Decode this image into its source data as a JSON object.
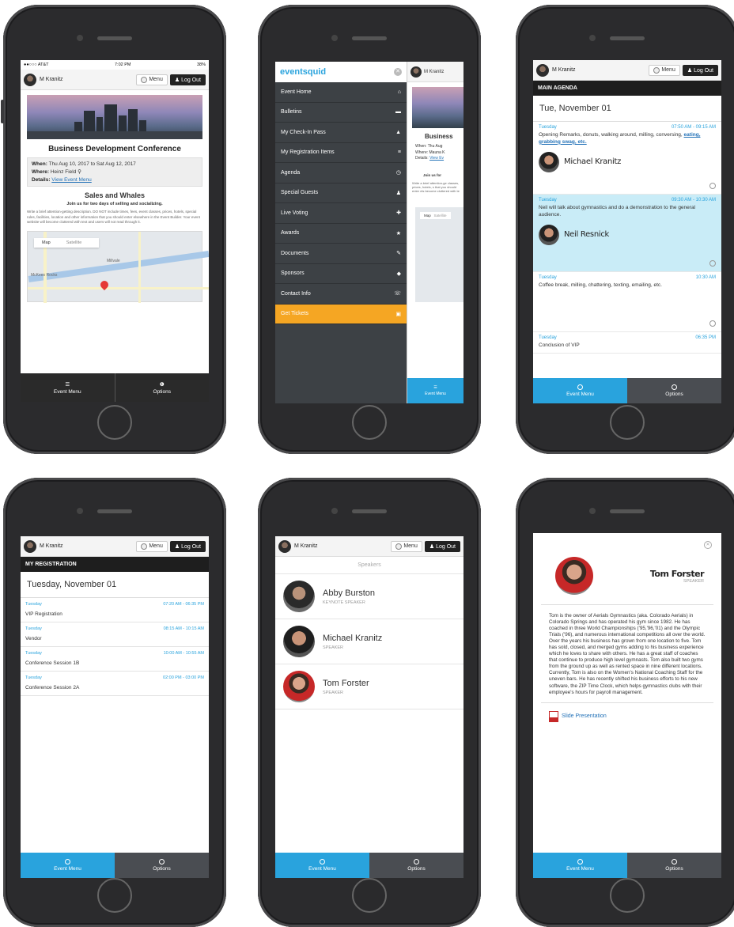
{
  "colors": {
    "accent": "#29a3dd",
    "dark": "#1e1e1e",
    "tickets": "#f5a623"
  },
  "user": "M Kranitz",
  "header": {
    "menu": "Menu",
    "logout": "Log Out"
  },
  "tabs": {
    "event_menu": "Event Menu",
    "options": "Options"
  },
  "phone1": {
    "status": {
      "carrier": "●●○○○ AT&T",
      "time": "7:02 PM",
      "battery": "38%"
    },
    "title": "Business Development Conference",
    "when_label": "When:",
    "when": "Thu Aug 10, 2017 to Sat Aug 12, 2017",
    "where_label": "Where:",
    "where": "Heinz Field",
    "details_label": "Details:",
    "details_link": "View Event Menu",
    "subtitle": "Sales and Whales",
    "tagline": "Join us for two days of selling and socializing.",
    "description": "Write a brief attention-getting description. DO NOT include times, fees, event classes, prices, hotels, special rules, facilities, location and other information that you should enter elsewhere in the Event Builder. Your event website will become cluttered with text and users will not read through it.",
    "map": {
      "map": "Map",
      "satellite": "Satellite",
      "place1": "Millvale",
      "place2": "McKees Rocks"
    }
  },
  "phone2": {
    "logo": "eventsquid",
    "items": [
      {
        "label": "Event Home",
        "icon": "⌂"
      },
      {
        "label": "Bulletins",
        "icon": "▬"
      },
      {
        "label": "My Check-In Pass",
        "icon": "▲"
      },
      {
        "label": "My Registration Items",
        "icon": "≡"
      },
      {
        "label": "Agenda",
        "icon": "◷"
      },
      {
        "label": "Special Guests",
        "icon": "♟"
      },
      {
        "label": "Live Voting",
        "icon": "✚"
      },
      {
        "label": "Awards",
        "icon": "★"
      },
      {
        "label": "Documents",
        "icon": "✎"
      },
      {
        "label": "Sponsors",
        "icon": "◆"
      },
      {
        "label": "Contact Info",
        "icon": "☏"
      },
      {
        "label": "Get Tickets",
        "icon": "▣"
      }
    ],
    "peek": {
      "title": "Business",
      "when": "When: Thu Aug",
      "where": "Where: Mauna K",
      "details": "Details:",
      "details_link": "View Ev",
      "join": "Join us for",
      "desc": "Write a brief attention-ge classes, prices, hotels, s that you should enter els become cluttered with te",
      "map": "Map",
      "satellite": "Satellite"
    }
  },
  "phone3": {
    "section": "MAIN AGENDA",
    "day": "Tue, November 01",
    "items": [
      {
        "day": "Tuesday",
        "time": "07:50 AM - 09:15 AM",
        "desc": "Opening Remarks, donuts, walking around, milling, conversing,",
        "link": "eating, grabbing swag, etc.",
        "speaker": "Michael Kranitz"
      },
      {
        "day": "Tuesday",
        "time": "09:30 AM - 10:30 AM",
        "desc": "Neil will talk about gymnastics and do a demonstration to the general audience.",
        "speaker": "Neil Resnick"
      },
      {
        "day": "Tuesday",
        "time": "10:30 AM",
        "desc": "Coffee break, milling, chattering, texting, emailing, etc."
      },
      {
        "day": "Tuesday",
        "time": "06:35 PM",
        "desc": "Conclusion of VIP"
      }
    ]
  },
  "phone4": {
    "section": "MY REGISTRATION",
    "day": "Tuesday, November 01",
    "items": [
      {
        "day": "Tuesday",
        "time": "07:20 AM - 06:35 PM",
        "name": "VIP Registration"
      },
      {
        "day": "Tuesday",
        "time": "08:15 AM - 10:15 AM",
        "name": "Vendor"
      },
      {
        "day": "Tuesday",
        "time": "10:00 AM - 10:55 AM",
        "name": "Conference Session 1B"
      },
      {
        "day": "Tuesday",
        "time": "02:00 PM - 03:00 PM",
        "name": "Conference Session 2A"
      }
    ]
  },
  "phone5": {
    "heading": "Speakers",
    "items": [
      {
        "name": "Abby Burston",
        "role": "KEYNOTE SPEAKER"
      },
      {
        "name": "Michael Kranitz",
        "role": "SPEAKER"
      },
      {
        "name": "Tom Forster",
        "role": "SPEAKER"
      }
    ]
  },
  "phone6": {
    "name": "Tom Forster",
    "role": "SPEAKER",
    "bio": "Tom is the owner of Aerials Gymnastics (aka. Colorado Aerials) in Colorado Springs and has operated his gym since 1982. He has coached in three World Championships ('95,'96,'01) and the Olympic Trials ('96), and numerous international competitions all over the world. Over the years his business has grown from one location to five. Tom has sold, closed, and merged gyms adding to his business experience which he loves to share with others. He has a great staff of coaches that continue to produce high level gymnasts. Tom also built two gyms from the ground up as well as rented space in nine different locations. Currently, Tom is also on the Women's National Coaching Staff for the uneven bars. He has recently shifted his business efforts to his new software, the ZIP Time Clock, which helps gymnastics clubs with their employee's hours for payroll management.",
    "slide": "Slide Presentation"
  }
}
